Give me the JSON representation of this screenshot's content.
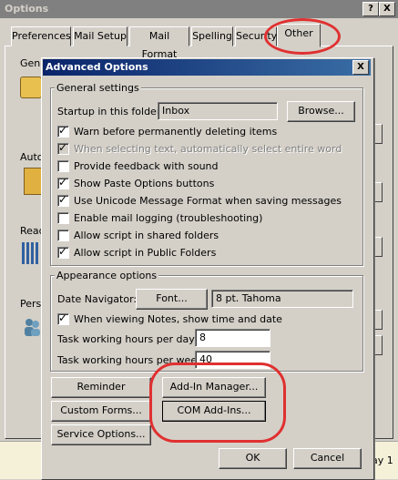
{
  "outer": {
    "title": "Options",
    "help_btn": "?",
    "close_btn": "X",
    "tabs": [
      "Preferences",
      "Mail Setup",
      "Mail Format",
      "Spelling",
      "Security",
      "Other"
    ],
    "section_labels": [
      "Gene",
      "Auto",
      "Read",
      "Pers"
    ],
    "bottom_text": "ay 1"
  },
  "dialog": {
    "title": "Advanced Options",
    "close_btn": "X",
    "general": {
      "legend": "General settings",
      "startup_label": "Startup in this folder:",
      "startup_value": "Inbox",
      "browse": "Browse...",
      "options": [
        {
          "label": "Warn before permanently deleting items",
          "checked": true,
          "disabled": false
        },
        {
          "label": "When selecting text, automatically select entire word",
          "checked": true,
          "disabled": true
        },
        {
          "label": "Provide feedback with sound",
          "checked": false,
          "disabled": false
        },
        {
          "label": "Show Paste Options buttons",
          "checked": true,
          "disabled": false
        },
        {
          "label": "Use Unicode Message Format when saving messages",
          "checked": true,
          "disabled": false
        },
        {
          "label": "Enable mail logging (troubleshooting)",
          "checked": false,
          "disabled": false
        },
        {
          "label": "Allow script in shared folders",
          "checked": false,
          "disabled": false
        },
        {
          "label": "Allow script in Public Folders",
          "checked": true,
          "disabled": false
        }
      ]
    },
    "appearance": {
      "legend": "Appearance options",
      "date_nav_label": "Date Navigator:",
      "font_btn": "Font...",
      "font_value": "8 pt. Tahoma",
      "notes_time": {
        "label": "When viewing Notes, show time and date",
        "checked": true
      },
      "hours_day_label": "Task working hours per day:",
      "hours_day": "8",
      "hours_week_label": "Task working hours per week:",
      "hours_week": "40"
    },
    "buttons": {
      "reminder": "Reminder Options...",
      "addin_manager": "Add-In Manager...",
      "custom_forms": "Custom Forms...",
      "com_addins": "COM Add-Ins...",
      "service": "Service Options...",
      "ok": "OK",
      "cancel": "Cancel"
    }
  }
}
